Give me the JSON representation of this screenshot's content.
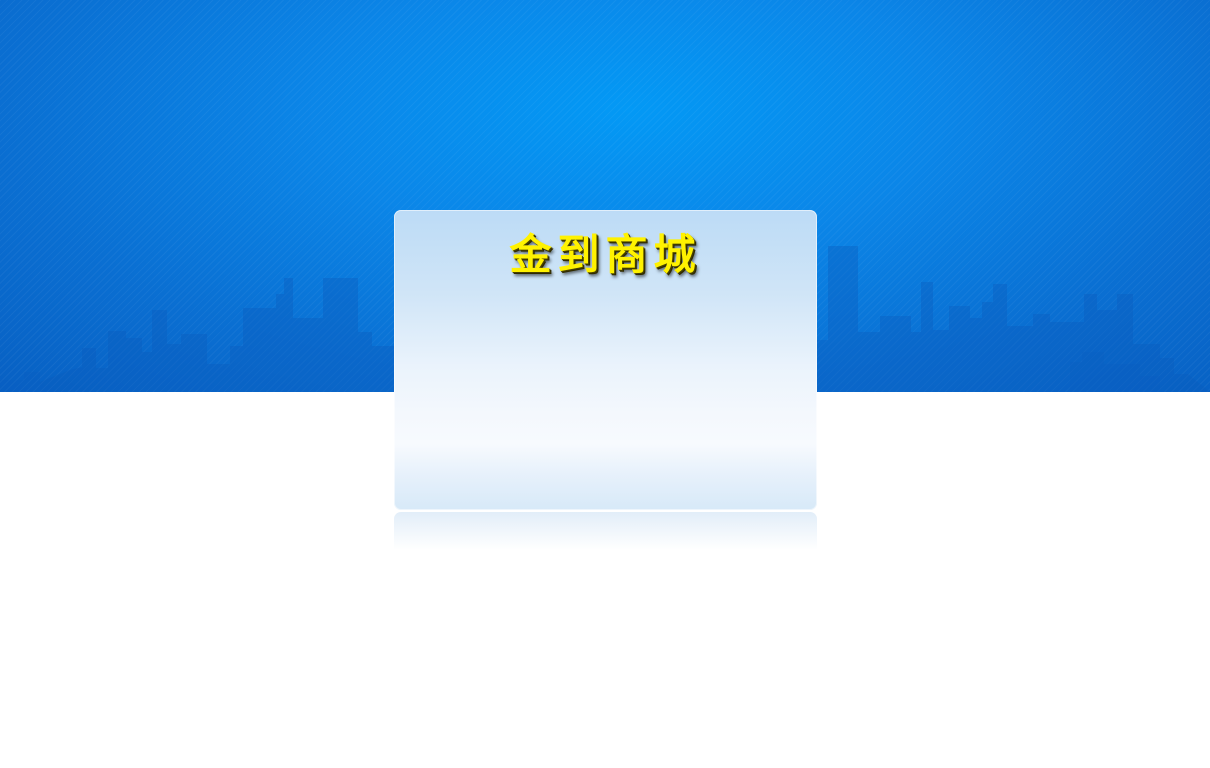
{
  "login_card": {
    "title": "金到商城"
  },
  "colors": {
    "hero_blue_light": "#0399f5",
    "hero_blue_dark": "#0860c3",
    "title_yellow": "#fff200",
    "card_blue_light": "#bcdbf6"
  },
  "icons": [
    "city-skyline-icon"
  ]
}
